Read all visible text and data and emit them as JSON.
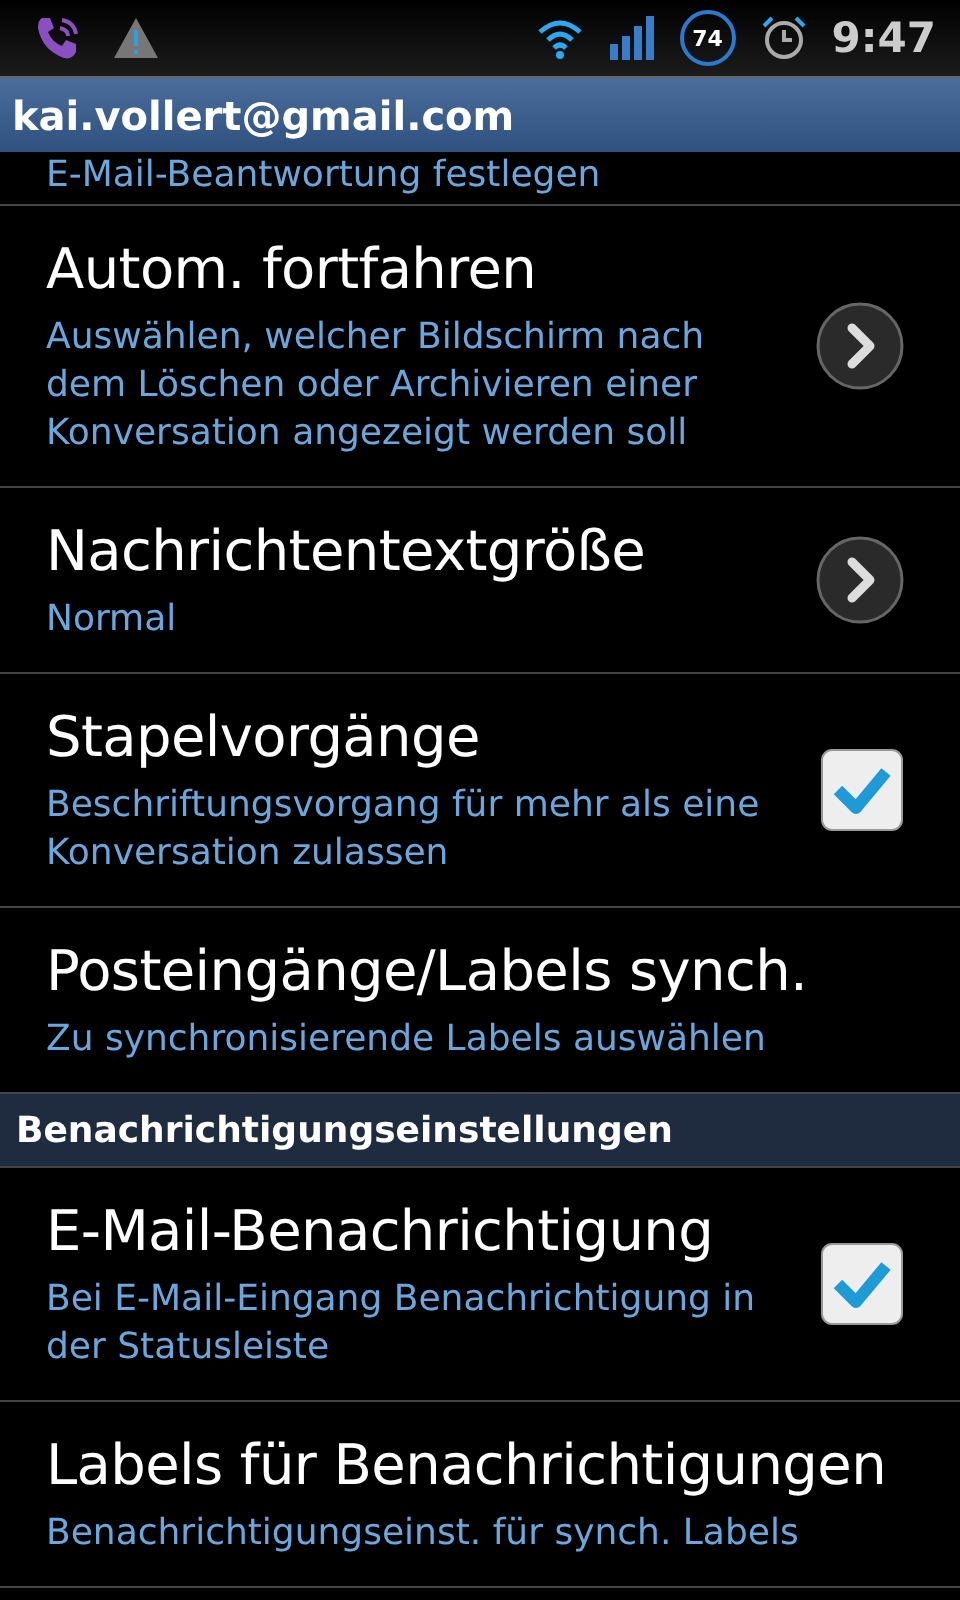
{
  "status_bar": {
    "battery": "74",
    "time": "9:47"
  },
  "header": {
    "title": "kai.vollert@gmail.com"
  },
  "clipped_summary": "E-Mail-Beantwortung festlegen",
  "sections": [
    {
      "items": [
        {
          "kind": "arrow",
          "title": "Autom. fortfahren",
          "summary": "Auswählen, welcher Bildschirm nach dem Löschen oder Archivieren einer Konversation angezeigt werden soll"
        },
        {
          "kind": "arrow",
          "title": "Nachrichtentextgröße",
          "summary": "Normal"
        },
        {
          "kind": "checkbox",
          "checked": true,
          "title": "Stapelvorgänge",
          "summary": "Beschriftungsvorgang für mehr als eine Konversation zulassen"
        },
        {
          "kind": "plain",
          "title": "Posteingänge/Labels synch.",
          "summary": "Zu synchronisierende Labels auswählen"
        }
      ]
    },
    {
      "heading": "Benachrichtigungseinstellungen",
      "items": [
        {
          "kind": "checkbox",
          "checked": true,
          "title": "E-Mail-Benachrichtigung",
          "summary": "Bei E-Mail-Eingang Benachrichtigung in der Statusleiste"
        },
        {
          "kind": "plain",
          "title": "Labels für Benachrichtigungen",
          "summary": "Benachrichtigungseinst. für synch. Labels"
        }
      ]
    }
  ]
}
